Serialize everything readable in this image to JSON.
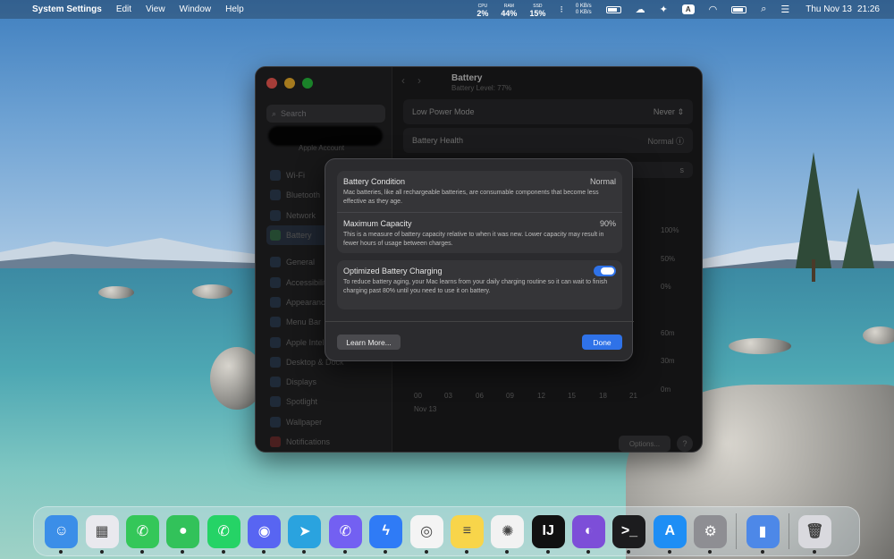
{
  "menubar": {
    "app_name": "System Settings",
    "menus": [
      "Edit",
      "View",
      "Window",
      "Help"
    ],
    "stats": [
      {
        "label": "CPU",
        "value": "2%"
      },
      {
        "label": "RAM",
        "value": "44%"
      },
      {
        "label": "SSD",
        "value": "15%"
      }
    ],
    "net_up": "0 KB/s",
    "net_down": "0 KB/s",
    "input_badge": "A",
    "date": "Thu Nov 13",
    "time": "21:26"
  },
  "sidebar": {
    "search_placeholder": "Search",
    "account_sub": "Apple Account",
    "items_group1": [
      "Wi-Fi",
      "Bluetooth",
      "Network",
      "Battery"
    ],
    "items_group2": [
      "General",
      "Accessibility",
      "Appearance",
      "Menu Bar",
      "Apple Intelligence",
      "Desktop & Dock",
      "Displays",
      "Spotlight",
      "Wallpaper",
      "Notifications"
    ]
  },
  "content": {
    "title": "Battery",
    "subtitle": "Battery Level: 77%",
    "low_power_label": "Low Power Mode",
    "low_power_value": "Never",
    "health_label": "Battery Health",
    "health_value": "Normal",
    "partial_tab": "s",
    "y_pct": [
      "100%",
      "50%",
      "0%"
    ],
    "y_min": [
      "60m",
      "30m",
      "0m"
    ],
    "x_ticks": [
      "00",
      "03",
      "06",
      "09",
      "12",
      "15",
      "18",
      "21"
    ],
    "date_label": "Nov 13",
    "options_label": "Options...",
    "help_label": "?"
  },
  "sheet": {
    "condition_title": "Battery Condition",
    "condition_value": "Normal",
    "condition_desc": "Mac batteries, like all rechargeable batteries, are consumable components that become less effective as they age.",
    "capacity_title": "Maximum Capacity",
    "capacity_value": "90%",
    "capacity_desc": "This is a measure of battery capacity relative to when it was new. Lower capacity may result in fewer hours of usage between charges.",
    "optimized_title": "Optimized Battery Charging",
    "optimized_desc": "To reduce battery aging, your Mac learns from your daily charging routine so it can wait to finish charging past 80% until you need to use it on battery.",
    "optimized_on": true,
    "learn_more_label": "Learn More...",
    "done_label": "Done"
  },
  "dock": {
    "apps": [
      {
        "name": "finder-icon",
        "color": "#3b8ee8",
        "glyph": "☺"
      },
      {
        "name": "launchpad-icon",
        "color": "#e9e9ee",
        "glyph": "▦"
      },
      {
        "name": "phone-icon",
        "color": "#34c759",
        "glyph": "✆"
      },
      {
        "name": "messages-icon",
        "color": "#32c25a",
        "glyph": "●"
      },
      {
        "name": "whatsapp-icon",
        "color": "#25d366",
        "glyph": "✆"
      },
      {
        "name": "discord-icon",
        "color": "#5865f2",
        "glyph": "◉"
      },
      {
        "name": "telegram-icon",
        "color": "#2aa3df",
        "glyph": "➤"
      },
      {
        "name": "viber-icon",
        "color": "#7360f2",
        "glyph": "✆"
      },
      {
        "name": "messenger-icon",
        "color": "#2f7bf6",
        "glyph": "ϟ"
      },
      {
        "name": "chrome-icon",
        "color": "#f4f4f4",
        "glyph": "◎"
      },
      {
        "name": "notes-icon",
        "color": "#f8d54a",
        "glyph": "≡"
      },
      {
        "name": "chatgpt-icon",
        "color": "#f2f2f2",
        "glyph": "✺"
      },
      {
        "name": "intellij-icon",
        "color": "#111111",
        "glyph": "IJ"
      },
      {
        "name": "github-desktop-icon",
        "color": "#7d4ed8",
        "glyph": "◐"
      },
      {
        "name": "terminal-icon",
        "color": "#1c1c1e",
        "glyph": ">_"
      },
      {
        "name": "app-store-icon",
        "color": "#1e8ef5",
        "glyph": "A"
      },
      {
        "name": "system-settings-icon",
        "color": "#8e8e93",
        "glyph": "⚙"
      }
    ],
    "recent": [
      {
        "name": "battery-app-icon",
        "color": "#4d88e8",
        "glyph": "▮"
      }
    ],
    "trash": {
      "name": "trash-icon",
      "color": "#d9d9de",
      "glyph": "🗑"
    }
  }
}
